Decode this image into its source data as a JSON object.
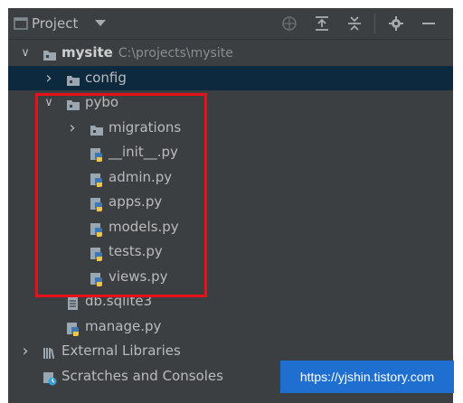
{
  "header": {
    "title": "Project",
    "dropdown_icon": "triangle-down-icon",
    "tools": [
      "globe-icon",
      "expand-all-icon",
      "collapse-all-icon",
      "gear-icon",
      "minimize-icon"
    ]
  },
  "tree": [
    {
      "label": "mysite",
      "path": "C:\\projects\\mysite",
      "icon": "folder-icon",
      "expanded": true,
      "depth": 0
    },
    {
      "label": "config",
      "icon": "folder-icon",
      "expanded": false,
      "depth": 1,
      "selected": true
    },
    {
      "label": "pybo",
      "icon": "folder-icon",
      "expanded": true,
      "depth": 1
    },
    {
      "label": "migrations",
      "icon": "folder-icon",
      "expanded": false,
      "depth": 2
    },
    {
      "label": "__init__.py",
      "icon": "python-file-icon",
      "depth": 2
    },
    {
      "label": "admin.py",
      "icon": "python-file-icon",
      "depth": 2
    },
    {
      "label": "apps.py",
      "icon": "python-file-icon",
      "depth": 2
    },
    {
      "label": "models.py",
      "icon": "python-file-icon",
      "depth": 2
    },
    {
      "label": "tests.py",
      "icon": "python-file-icon",
      "depth": 2
    },
    {
      "label": "views.py",
      "icon": "python-file-icon",
      "depth": 2
    },
    {
      "label": "db.sqlite3",
      "icon": "text-file-icon",
      "depth": 1
    },
    {
      "label": "manage.py",
      "icon": "python-file-icon",
      "depth": 1
    },
    {
      "label": "External Libraries",
      "icon": "libraries-icon",
      "expanded": false,
      "depth": 0
    },
    {
      "label": "Scratches and Consoles",
      "icon": "scratches-icon",
      "depth": 0
    }
  ],
  "watermark": "https://yjshin.tistory.com",
  "colors": {
    "panel_bg": "#3c3f41",
    "selected_bg": "#0d293e",
    "highlight": "#e8101a",
    "watermark_bg": "#1f6fd1",
    "python_blue": "#3b78b8",
    "python_yellow": "#f5c342"
  }
}
